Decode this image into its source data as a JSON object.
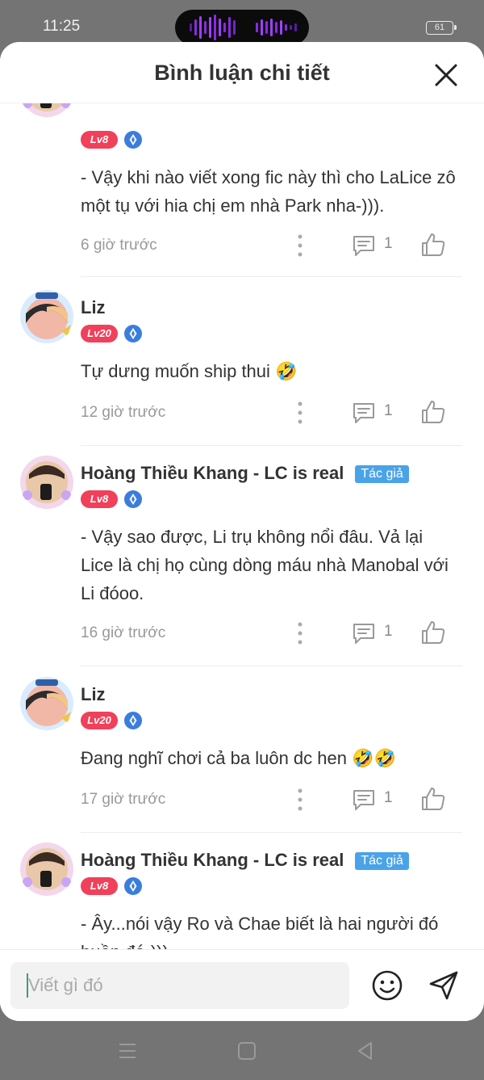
{
  "status_bar": {
    "time": "11:25",
    "battery": "61"
  },
  "header": {
    "title": "Bình luận chi tiết"
  },
  "comments": [
    {
      "name": "",
      "level": "Lv8",
      "is_author": false,
      "text": "- Vậy khi nào viết xong fic này thì cho LaLice zô một tụ với hia chị em nhà Park nha-))).",
      "time": "6 giờ trước",
      "reply_count": "1"
    },
    {
      "name": "Liz",
      "level": "Lv20",
      "is_author": false,
      "text": "Tự dưng muốn ship thui 🤣",
      "time": "12 giờ trước",
      "reply_count": "1"
    },
    {
      "name": "Hoàng Thiều Khang - LC is real",
      "author_badge": "Tác giả",
      "level": "Lv8",
      "is_author": true,
      "text": "- Vậy sao được, Li trụ không nổi đâu. Vả lại Lice là chị họ cùng dòng máu nhà Manobal với Li đóoo.",
      "time": "16 giờ trước",
      "reply_count": "1"
    },
    {
      "name": "Liz",
      "level": "Lv20",
      "is_author": false,
      "text": "Đang nghĩ chơi cả ba luôn dc hen 🤣🤣",
      "time": "17 giờ trước",
      "reply_count": "1"
    },
    {
      "name": "Hoàng Thiều Khang - LC is real",
      "author_badge": "Tác giả",
      "level": "Lv8",
      "is_author": true,
      "text": "- Ây...nói vậy Ro và Chae biết là hai người đó buồn đó-)))",
      "time": "",
      "reply_count": ""
    }
  ],
  "input": {
    "placeholder": "Viết gì đó",
    "value": ""
  },
  "colors": {
    "level_badge": "#f0405a",
    "author_badge": "#4aa3e8",
    "vip_icon": "#3b7ddd",
    "cursor": "#3d9a88"
  }
}
